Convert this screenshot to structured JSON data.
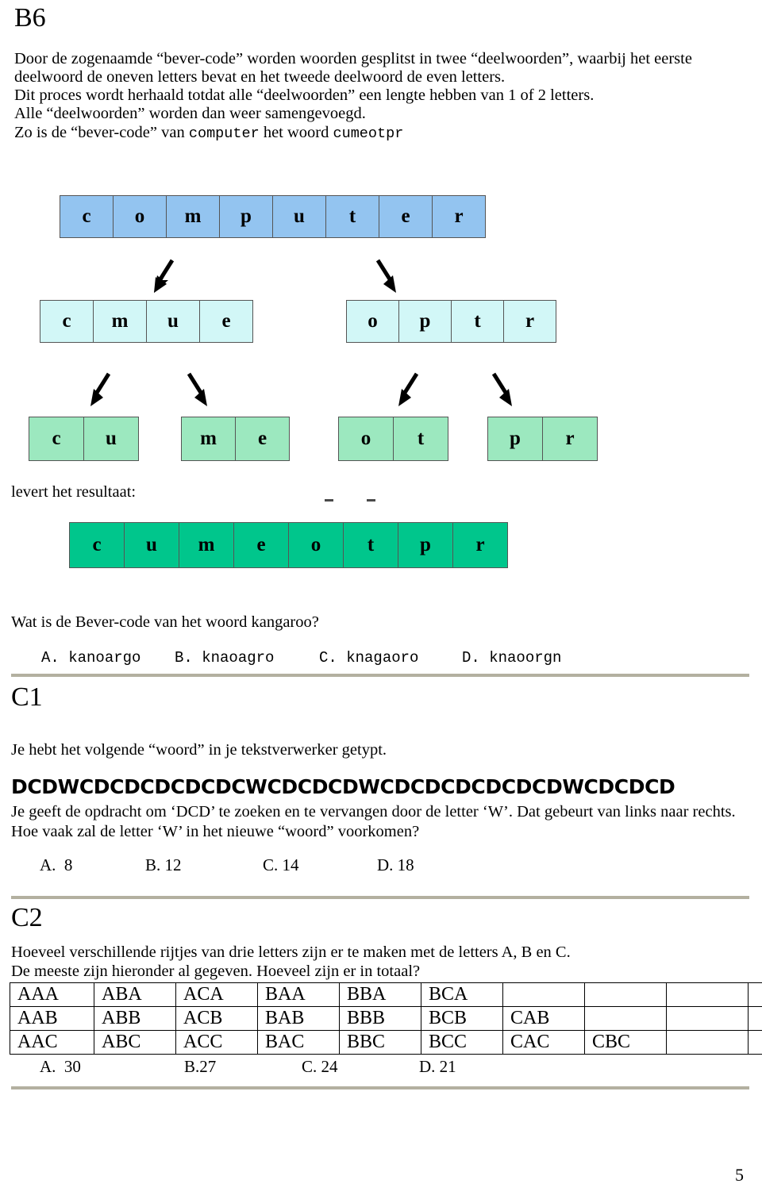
{
  "document": {
    "page_number": "5"
  },
  "b6": {
    "heading": "B6",
    "intro_lines": [
      "Door de zogenaamde “bever-code” worden woorden gesplitst in twee “deelwoorden”, waarbij het eerste",
      "deelwoord de oneven letters bevat en het tweede deelwoord de even letters.",
      "Dit proces wordt herhaald totdat alle “deelwoorden” een lengte hebben van 1 of 2 letters.",
      "Alle “deelwoorden” worden dan weer samengevoegd."
    ],
    "example_line": {
      "prefix": "Zo is de “bever-code” van ",
      "word_in": "computer",
      "middle": " het woord ",
      "word_out": "cumeotpr"
    },
    "diagram": {
      "level0": [
        "c",
        "o",
        "m",
        "p",
        "u",
        "t",
        "e",
        "r"
      ],
      "level1_group_a": [
        "c",
        "m",
        "u",
        "e"
      ],
      "level1_group_b": [
        "o",
        "p",
        "t",
        "r"
      ],
      "level2_groups": [
        [
          "c",
          "u"
        ],
        [
          "m",
          "e"
        ],
        [
          "o",
          "t"
        ],
        [
          "p",
          "r"
        ]
      ],
      "result": [
        "c",
        "u",
        "m",
        "e",
        "o",
        "t",
        "p",
        "r"
      ],
      "result_label": "levert het resultaat:",
      "colors": {
        "level0": "#93c4f0",
        "level1": "#d2f7f7",
        "level2": "#9ce8bf",
        "result": "#00c68c",
        "border": "#555555"
      }
    },
    "question": "Wat is de Bever-code van het woord kangaroo?",
    "options": [
      "A. kanoargo",
      "B. knaoagro",
      "C. knagaoro",
      "D. knaoorgn"
    ]
  },
  "c1": {
    "heading": "C1",
    "intro": "Je hebt het volgende “woord” in je tekstverwerker getypt.",
    "word": "DCDWCDCDCDCDCDCWCDCDCDWCDCDCDCDCDCDWCDCDCD",
    "body_lines": [
      "Je geeft de opdracht om ‘DCD’ te zoeken en te vervangen door de letter ‘W’. Dat gebeurt van links naar rechts.",
      "Hoe vaak zal de letter ‘W’ in het nieuwe “woord” voorkomen?"
    ],
    "options": [
      "A.  8",
      "B. 12",
      "C. 14",
      "D. 18"
    ]
  },
  "c2": {
    "heading": "C2",
    "body_lines": [
      "Hoeveel verschillende rijtjes van drie letters zijn er te maken met de letters A, B en C.",
      "De meeste zijn hieronder al gegeven. Hoeveel zijn er in totaal?"
    ],
    "table": {
      "columns": 10,
      "rows": [
        [
          "AAA",
          "ABA",
          "ACA",
          "BAA",
          "BBA",
          "BCA",
          "",
          "",
          "",
          ""
        ],
        [
          "AAB",
          "ABB",
          "ACB",
          "BAB",
          "BBB",
          "BCB",
          "CAB",
          "",
          "",
          ""
        ],
        [
          "AAC",
          "ABC",
          "ACC",
          "BAC",
          "BBC",
          "BCC",
          "CAC",
          "CBC",
          "",
          ""
        ]
      ]
    },
    "options": [
      "A.  30",
      "B.27",
      "C. 24",
      "D. 21"
    ]
  }
}
